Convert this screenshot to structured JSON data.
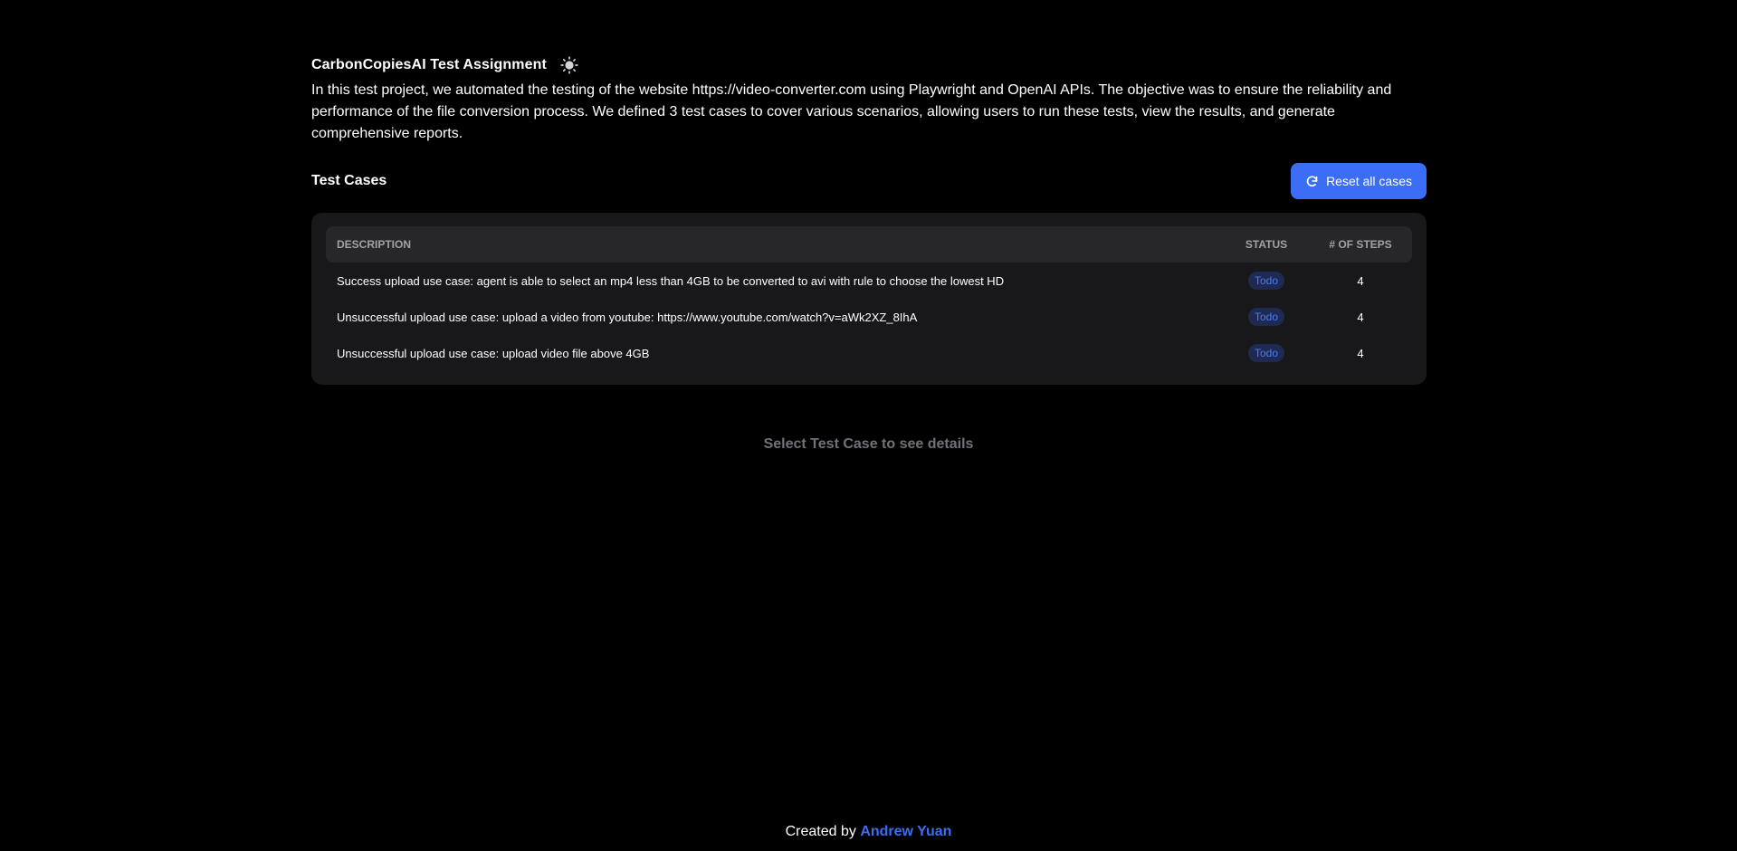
{
  "header": {
    "title": "CarbonCopiesAI Test Assignment",
    "theme_icon": "sun-icon"
  },
  "intro": "In this test project, we automated the testing of the website https://video-converter.com using Playwright and OpenAI APIs. The objective was to ensure the reliability and performance of the file conversion process. We defined 3 test cases to cover various scenarios, allowing users to run these tests, view the results, and generate comprehensive reports.",
  "test_cases": {
    "title": "Test Cases",
    "reset_label": "Reset all cases",
    "reset_icon": "refresh-icon",
    "columns": {
      "description": "DESCRIPTION",
      "status": "STATUS",
      "steps": "# OF STEPS"
    },
    "rows": [
      {
        "description": "Success upload use case: agent is able to select an mp4 less than 4GB to be converted to avi with rule to choose the lowest HD",
        "status": "Todo",
        "steps": "4"
      },
      {
        "description": "Unsuccessful upload use case: upload a video from youtube: https://www.youtube.com/watch?v=aWk2XZ_8IhA",
        "status": "Todo",
        "steps": "4"
      },
      {
        "description": "Unsuccessful upload use case: upload video file above 4GB",
        "status": "Todo",
        "steps": "4"
      }
    ]
  },
  "empty_state": "Select Test Case to see details",
  "footer": {
    "prefix": "Created by",
    "author": "Andrew Yuan"
  },
  "colors": {
    "background": "#000000",
    "card": "#18181b",
    "accent": "#3b6ef5",
    "badge_bg": "#1e2a52",
    "badge_text": "#4b7bf5"
  }
}
